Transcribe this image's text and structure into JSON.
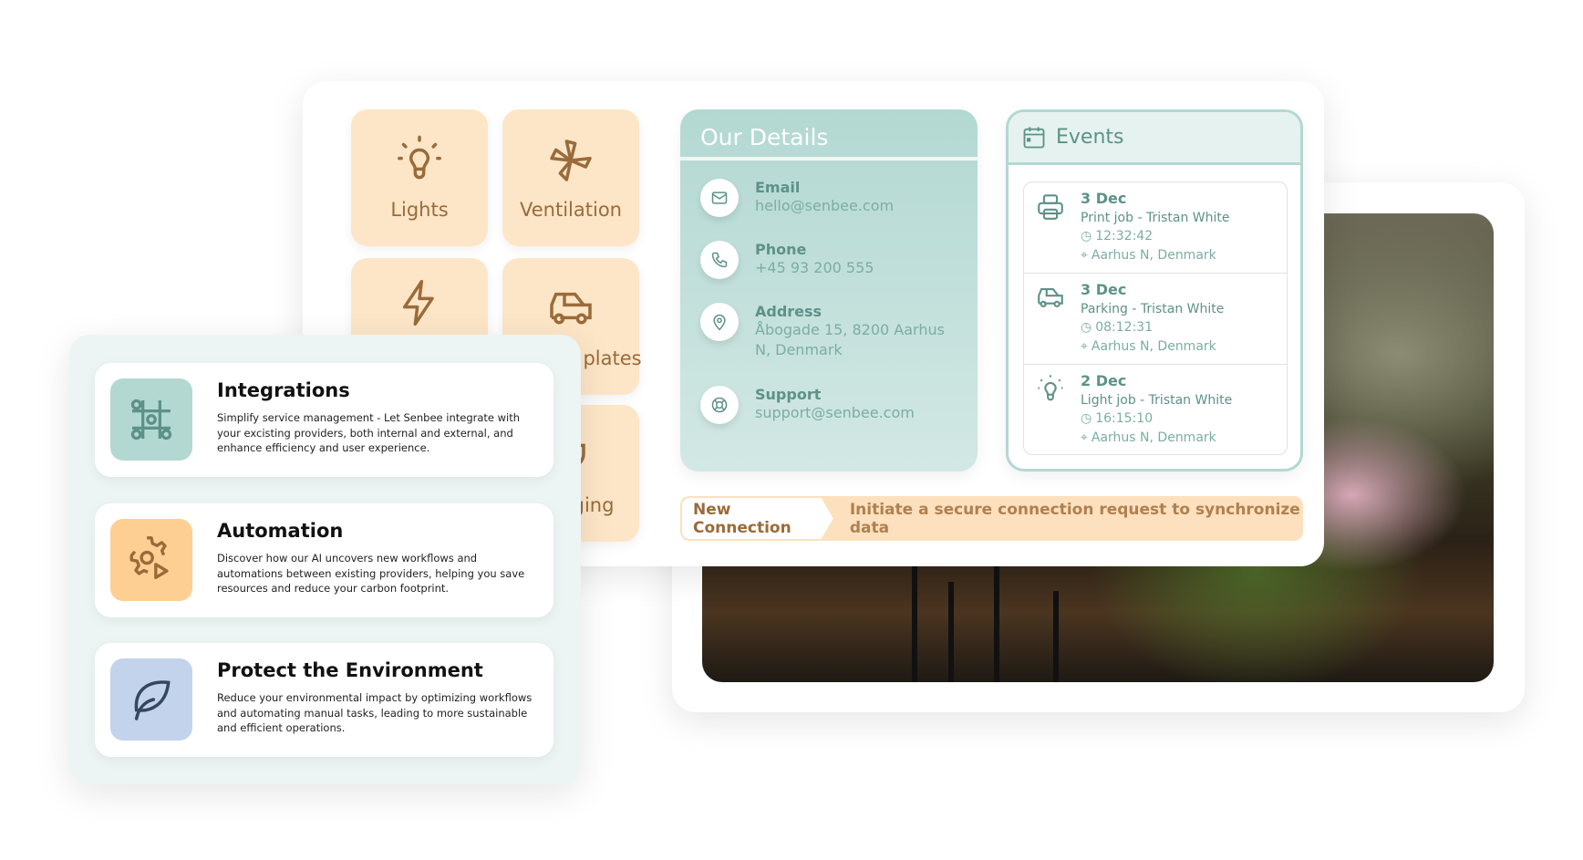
{
  "tiles": [
    {
      "label": "Lights",
      "icon": "lightbulb-icon"
    },
    {
      "label": "Ventilation",
      "icon": "fan-icon"
    },
    {
      "label": "",
      "icon": "lightning-icon"
    },
    {
      "label": "Number plates",
      "icon": "car-icon"
    },
    {
      "label": "",
      "icon": ""
    },
    {
      "label": "Charging",
      "icon": "plug-icon"
    }
  ],
  "details": {
    "title": "Our Details",
    "items": [
      {
        "label": "Email",
        "value": "hello@senbee.com",
        "icon": "mail-icon"
      },
      {
        "label": "Phone",
        "value": "+45 93 200 555",
        "icon": "phone-icon"
      },
      {
        "label": "Address",
        "value": "Åbogade 15, 8200 Aarhus N, Denmark",
        "icon": "location-pin-icon"
      },
      {
        "label": "Support",
        "value": "support@senbee.com",
        "icon": "lifebuoy-icon"
      }
    ]
  },
  "events": {
    "title": "Events",
    "items": [
      {
        "date": "3 Dec",
        "title": "Print job - Tristan White",
        "time": "12:32:42",
        "location": "Aarhus N, Denmark",
        "icon": "printer-icon"
      },
      {
        "date": "3 Dec",
        "title": "Parking - Tristan White",
        "time": "08:12:31",
        "location": "Aarhus N, Denmark",
        "icon": "car-icon"
      },
      {
        "date": "2 Dec",
        "title": "Light job - Tristan White",
        "time": "16:15:10",
        "location": "Aarhus N, Denmark",
        "icon": "lightbulb-icon"
      }
    ]
  },
  "connection": {
    "button": "New Connection",
    "text": "Initiate a secure connection request to synchronize data"
  },
  "features": [
    {
      "title": "Integrations",
      "desc": "Simplify service management - Let Senbee integrate with your excisting providers, both internal and external, and enhance efficiency and user experience.",
      "color": "#b3d8d2"
    },
    {
      "title": "Automation",
      "desc": "Discover how our AI uncovers new workflows and automations between existing providers, helping you save resources and reduce your carbon footprint.",
      "color": "#fecf92"
    },
    {
      "title": "Protect the Environment",
      "desc": "Reduce your environmental impact by optimizing workflows and automating manual tasks, leading to more sustainable and efficient operations.",
      "color": "#c3d3ec"
    }
  ],
  "colors": {
    "teal": "#b3d8d2",
    "peach": "#fde6c7",
    "brown": "#9a6b3a",
    "teal_text": "#5c9288"
  }
}
